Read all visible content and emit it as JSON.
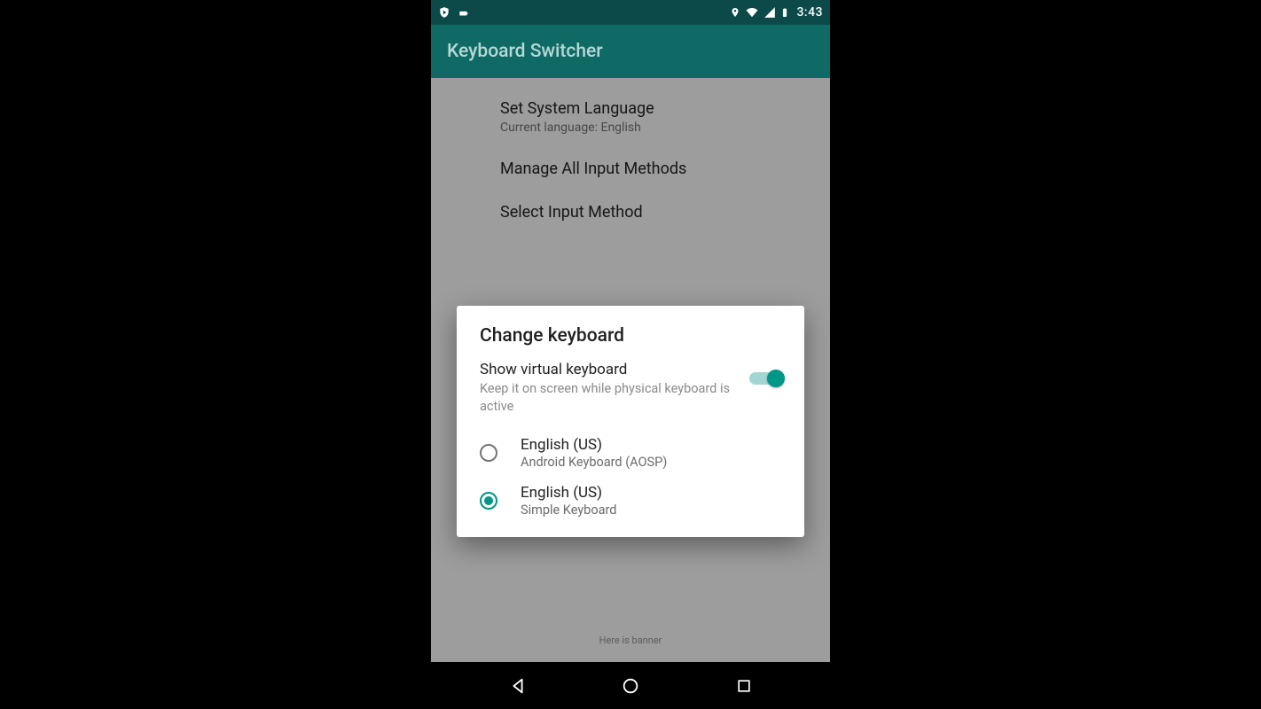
{
  "status": {
    "clock": "3:43"
  },
  "appbar": {
    "title": "Keyboard Switcher"
  },
  "list": {
    "items": [
      {
        "title": "Set System Language",
        "sub": "Current language: English"
      },
      {
        "title": "Manage All Input Methods",
        "sub": ""
      },
      {
        "title": "Select Input Method",
        "sub": ""
      }
    ]
  },
  "dialog": {
    "title": "Change keyboard",
    "toggle": {
      "title": "Show virtual keyboard",
      "sub": "Keep it on screen while physical keyboard is active",
      "on": true
    },
    "options": [
      {
        "title": "English (US)",
        "sub": "Android Keyboard (AOSP)",
        "selected": false
      },
      {
        "title": "English (US)",
        "sub": "Simple Keyboard",
        "selected": true
      }
    ]
  },
  "banner": "Here is banner"
}
